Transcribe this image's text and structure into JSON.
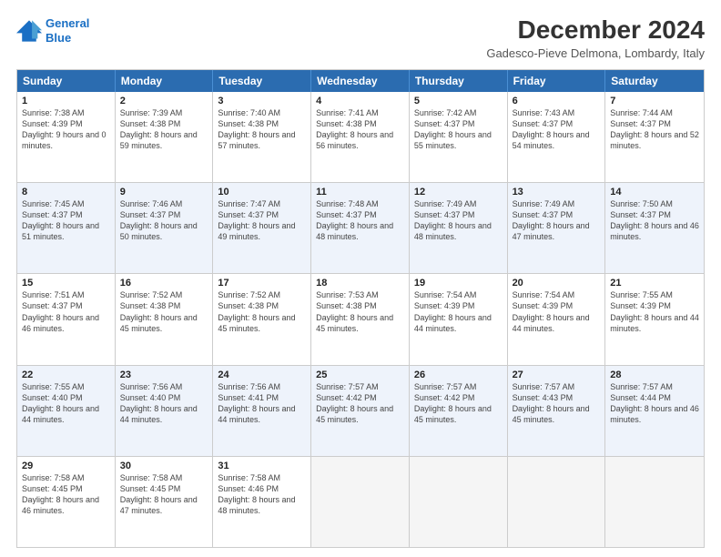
{
  "header": {
    "logo_line1": "General",
    "logo_line2": "Blue",
    "month_title": "December 2024",
    "location": "Gadesco-Pieve Delmona, Lombardy, Italy"
  },
  "weekdays": [
    "Sunday",
    "Monday",
    "Tuesday",
    "Wednesday",
    "Thursday",
    "Friday",
    "Saturday"
  ],
  "weeks": [
    [
      {
        "day": "1",
        "sunrise": "7:38 AM",
        "sunset": "4:39 PM",
        "daylight": "9 hours and 0 minutes."
      },
      {
        "day": "2",
        "sunrise": "7:39 AM",
        "sunset": "4:38 PM",
        "daylight": "8 hours and 59 minutes."
      },
      {
        "day": "3",
        "sunrise": "7:40 AM",
        "sunset": "4:38 PM",
        "daylight": "8 hours and 57 minutes."
      },
      {
        "day": "4",
        "sunrise": "7:41 AM",
        "sunset": "4:38 PM",
        "daylight": "8 hours and 56 minutes."
      },
      {
        "day": "5",
        "sunrise": "7:42 AM",
        "sunset": "4:37 PM",
        "daylight": "8 hours and 55 minutes."
      },
      {
        "day": "6",
        "sunrise": "7:43 AM",
        "sunset": "4:37 PM",
        "daylight": "8 hours and 54 minutes."
      },
      {
        "day": "7",
        "sunrise": "7:44 AM",
        "sunset": "4:37 PM",
        "daylight": "8 hours and 52 minutes."
      }
    ],
    [
      {
        "day": "8",
        "sunrise": "7:45 AM",
        "sunset": "4:37 PM",
        "daylight": "8 hours and 51 minutes."
      },
      {
        "day": "9",
        "sunrise": "7:46 AM",
        "sunset": "4:37 PM",
        "daylight": "8 hours and 50 minutes."
      },
      {
        "day": "10",
        "sunrise": "7:47 AM",
        "sunset": "4:37 PM",
        "daylight": "8 hours and 49 minutes."
      },
      {
        "day": "11",
        "sunrise": "7:48 AM",
        "sunset": "4:37 PM",
        "daylight": "8 hours and 48 minutes."
      },
      {
        "day": "12",
        "sunrise": "7:49 AM",
        "sunset": "4:37 PM",
        "daylight": "8 hours and 48 minutes."
      },
      {
        "day": "13",
        "sunrise": "7:49 AM",
        "sunset": "4:37 PM",
        "daylight": "8 hours and 47 minutes."
      },
      {
        "day": "14",
        "sunrise": "7:50 AM",
        "sunset": "4:37 PM",
        "daylight": "8 hours and 46 minutes."
      }
    ],
    [
      {
        "day": "15",
        "sunrise": "7:51 AM",
        "sunset": "4:37 PM",
        "daylight": "8 hours and 46 minutes."
      },
      {
        "day": "16",
        "sunrise": "7:52 AM",
        "sunset": "4:38 PM",
        "daylight": "8 hours and 45 minutes."
      },
      {
        "day": "17",
        "sunrise": "7:52 AM",
        "sunset": "4:38 PM",
        "daylight": "8 hours and 45 minutes."
      },
      {
        "day": "18",
        "sunrise": "7:53 AM",
        "sunset": "4:38 PM",
        "daylight": "8 hours and 45 minutes."
      },
      {
        "day": "19",
        "sunrise": "7:54 AM",
        "sunset": "4:39 PM",
        "daylight": "8 hours and 44 minutes."
      },
      {
        "day": "20",
        "sunrise": "7:54 AM",
        "sunset": "4:39 PM",
        "daylight": "8 hours and 44 minutes."
      },
      {
        "day": "21",
        "sunrise": "7:55 AM",
        "sunset": "4:39 PM",
        "daylight": "8 hours and 44 minutes."
      }
    ],
    [
      {
        "day": "22",
        "sunrise": "7:55 AM",
        "sunset": "4:40 PM",
        "daylight": "8 hours and 44 minutes."
      },
      {
        "day": "23",
        "sunrise": "7:56 AM",
        "sunset": "4:40 PM",
        "daylight": "8 hours and 44 minutes."
      },
      {
        "day": "24",
        "sunrise": "7:56 AM",
        "sunset": "4:41 PM",
        "daylight": "8 hours and 44 minutes."
      },
      {
        "day": "25",
        "sunrise": "7:57 AM",
        "sunset": "4:42 PM",
        "daylight": "8 hours and 45 minutes."
      },
      {
        "day": "26",
        "sunrise": "7:57 AM",
        "sunset": "4:42 PM",
        "daylight": "8 hours and 45 minutes."
      },
      {
        "day": "27",
        "sunrise": "7:57 AM",
        "sunset": "4:43 PM",
        "daylight": "8 hours and 45 minutes."
      },
      {
        "day": "28",
        "sunrise": "7:57 AM",
        "sunset": "4:44 PM",
        "daylight": "8 hours and 46 minutes."
      }
    ],
    [
      {
        "day": "29",
        "sunrise": "7:58 AM",
        "sunset": "4:45 PM",
        "daylight": "8 hours and 46 minutes."
      },
      {
        "day": "30",
        "sunrise": "7:58 AM",
        "sunset": "4:45 PM",
        "daylight": "8 hours and 47 minutes."
      },
      {
        "day": "31",
        "sunrise": "7:58 AM",
        "sunset": "4:46 PM",
        "daylight": "8 hours and 48 minutes."
      },
      null,
      null,
      null,
      null
    ]
  ]
}
